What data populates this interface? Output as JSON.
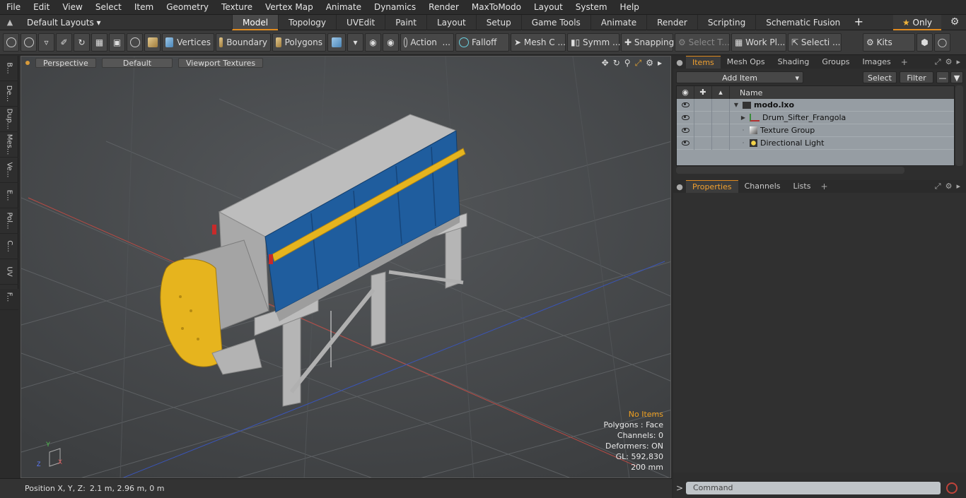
{
  "menu": [
    "File",
    "Edit",
    "View",
    "Select",
    "Item",
    "Geometry",
    "Texture",
    "Vertex Map",
    "Animate",
    "Dynamics",
    "Render",
    "MaxToModo",
    "Layout",
    "System",
    "Help"
  ],
  "layouts_label": "Default Layouts",
  "tabs": [
    "Model",
    "Topology",
    "UVEdit",
    "Paint",
    "Layout",
    "Setup",
    "Game Tools",
    "Animate",
    "Render",
    "Scripting",
    "Schematic Fusion"
  ],
  "only_label": "Only",
  "toolbar": {
    "vertices": "Vertices",
    "boundary": "Boundary",
    "polygons": "Polygons",
    "action": "Action",
    "action_dots": "...",
    "falloff": "Falloff",
    "mesh": "Mesh C ...",
    "symm": "Symm ...",
    "snapping": "Snapping",
    "select_t": "Select T...",
    "workpl": "Work Pl...",
    "selecti": "Selecti ...",
    "kits": "Kits"
  },
  "left_tabs": [
    "B...",
    "De...",
    "Dup...",
    "Mes...",
    "Ve...",
    "E...",
    "Pol...",
    "C...",
    "UV",
    "F..."
  ],
  "viewport": {
    "perspective": "Perspective",
    "default": "Default",
    "viewport_textures": "Viewport Textures",
    "info": {
      "no_items": "No Items",
      "polygons": "Polygons : Face",
      "channels": "Channels: 0",
      "deformers": "Deformers: ON",
      "gl": "GL: 592,830",
      "size": "200 mm"
    }
  },
  "status": {
    "label": "Position X, Y, Z:",
    "value": "2.1 m, 2.96 m, 0 m"
  },
  "items_panel": {
    "tabs": [
      "Items",
      "Mesh Ops",
      "Shading",
      "Groups",
      "Images"
    ],
    "add_item": "Add Item",
    "select": "Select",
    "filter": "Filter",
    "name_header": "Name",
    "rows": [
      {
        "name": "modo.lxo",
        "bold": true
      },
      {
        "name": "Drum_Sifter_Frangola"
      },
      {
        "name": "Texture Group"
      },
      {
        "name": "Directional Light"
      }
    ]
  },
  "props_panel": {
    "tabs": [
      "Properties",
      "Channels",
      "Lists"
    ]
  },
  "command": {
    "placeholder": "Command"
  },
  "colors": {
    "accent": "#e08a1e",
    "machine_blue": "#1f5d9e",
    "machine_yellow": "#e6b41e",
    "machine_gray": "#b9b9b9"
  }
}
